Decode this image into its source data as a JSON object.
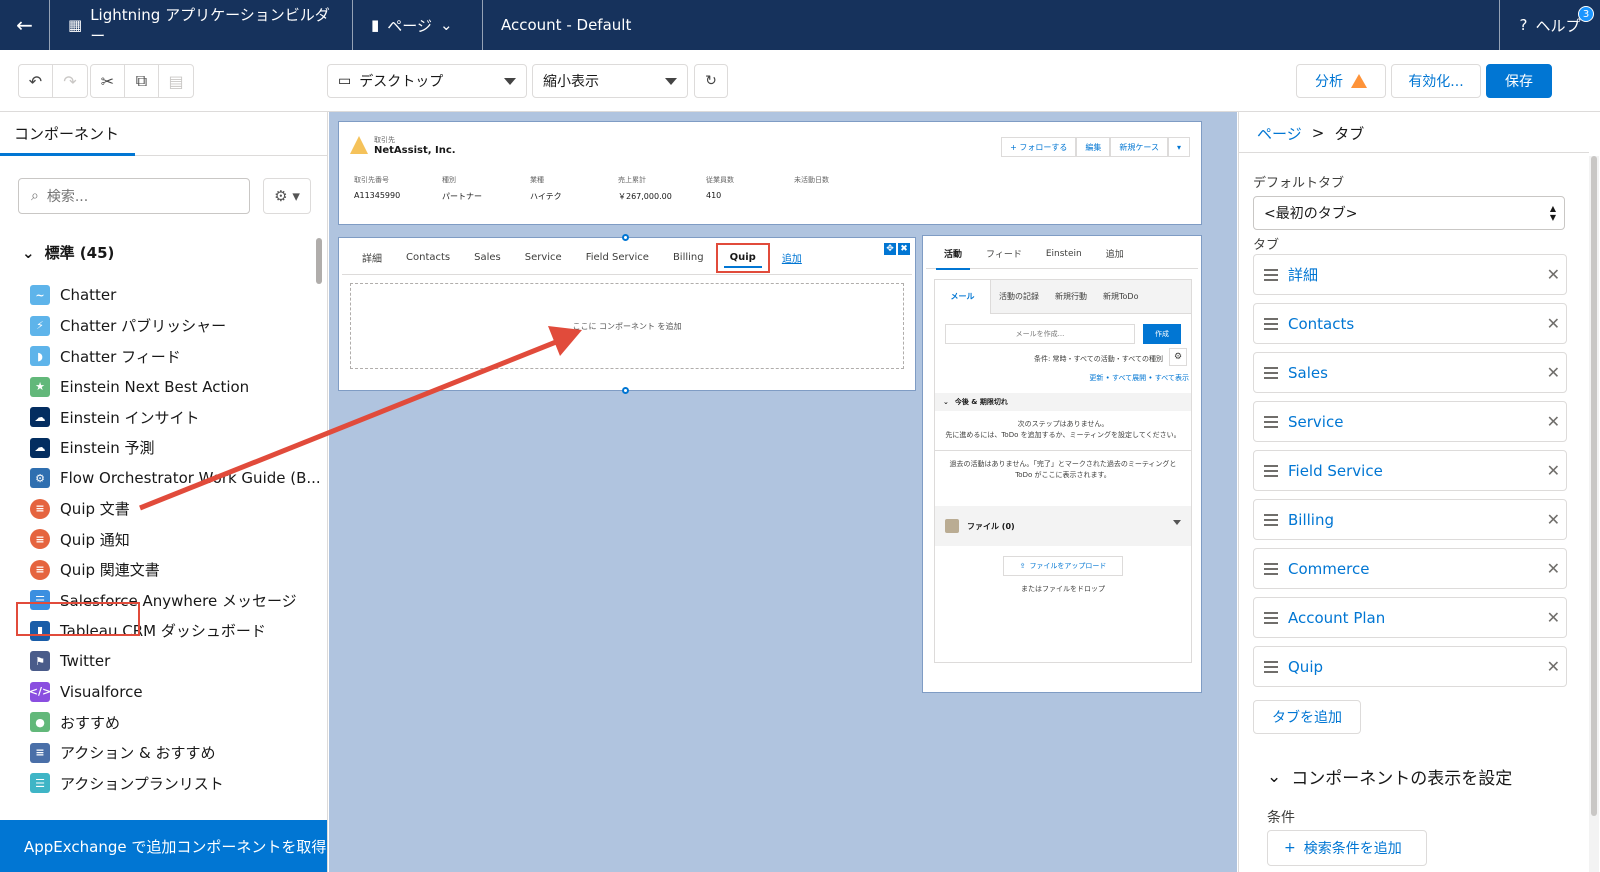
{
  "topbar": {
    "back_icon": "arrow-left-icon",
    "app_name": "Lightning アプリケーションビルダー",
    "page_menu": "ページ",
    "page_title": "Account - Default",
    "help": "ヘルプ",
    "help_badge": "3"
  },
  "toolbar": {
    "device": "デスクトップ",
    "zoom": "縮小表示",
    "analyze": "分析",
    "activate": "有効化...",
    "save": "保存"
  },
  "left": {
    "tab": "コンポーネント",
    "search_placeholder": "検索...",
    "section": "標準 (45)",
    "items": [
      {
        "label": "Chatter",
        "color": "#5eb4ea",
        "glyph": "~"
      },
      {
        "label": "Chatter パブリッシャー",
        "color": "#5eb4ea",
        "glyph": "⚡"
      },
      {
        "label": "Chatter フィード",
        "color": "#5eb4ea",
        "glyph": "◗"
      },
      {
        "label": "Einstein Next Best Action",
        "color": "#62b87a",
        "glyph": "★"
      },
      {
        "label": "Einstein インサイト",
        "color": "#032d60",
        "glyph": "☁"
      },
      {
        "label": "Einstein 予測",
        "color": "#032d60",
        "glyph": "☁"
      },
      {
        "label": "Flow Orchestrator Work Guide (B...",
        "color": "#2f6fb0",
        "glyph": "⚙"
      },
      {
        "label": "Quip 文書",
        "color": "#e5643f",
        "glyph": "≡"
      },
      {
        "label": "Quip 通知",
        "color": "#e5643f",
        "glyph": "≡"
      },
      {
        "label": "Quip 関連文書",
        "color": "#e5643f",
        "glyph": "≡"
      },
      {
        "label": "Salesforce Anywhere メッセージ",
        "color": "#3b8fe0",
        "glyph": "☰"
      },
      {
        "label": "Tableau CRM ダッシュボード",
        "color": "#1a5da8",
        "glyph": "▮"
      },
      {
        "label": "Twitter",
        "color": "#4a5c8a",
        "glyph": "⚑"
      },
      {
        "label": "Visualforce",
        "color": "#8a4ee0",
        "glyph": "</>"
      },
      {
        "label": "おすすめ",
        "color": "#62b87a",
        "glyph": "●"
      },
      {
        "label": "アクション & おすすめ",
        "color": "#4a6fa8",
        "glyph": "≡"
      },
      {
        "label": "アクションプランリスト",
        "color": "#3fb5c6",
        "glyph": "☰"
      }
    ],
    "appexchange": "AppExchange で追加コンポーネントを取得"
  },
  "canvas": {
    "record": {
      "type": "取引先",
      "name": "NetAssist, Inc.",
      "actions": [
        "+ フォローする",
        "編集",
        "新規ケース"
      ],
      "fields": [
        {
          "label": "取引先番号",
          "value": "A11345990"
        },
        {
          "label": "種別",
          "value": "パートナー"
        },
        {
          "label": "業種",
          "value": "ハイテク"
        },
        {
          "label": "売上累計",
          "value": "￥267,000.00"
        },
        {
          "label": "従業員数",
          "value": "410"
        },
        {
          "label": "未活動日数",
          "value": ""
        }
      ]
    },
    "tabs": [
      "詳細",
      "Contacts",
      "Sales",
      "Service",
      "Field Service",
      "Billing",
      "Quip"
    ],
    "tabs_more": "追加",
    "drop_text": "ここに コンポーネント を追加",
    "activity": {
      "tabs": [
        "活動",
        "フィード",
        "Einstein",
        "追加"
      ],
      "subtabs": [
        "メール",
        "活動の記録",
        "新規行動",
        "新規ToDo"
      ],
      "mail_placeholder": "メールを作成...",
      "mail_button": "作成",
      "filter": "条件: 常時・すべての活動・すべての種別",
      "links": "更新 • すべて展開 • すべて表示",
      "upcoming": "今後 & 期限切れ",
      "no_steps": "次のステップはありません。",
      "no_steps_hint": "先に進めるには、ToDo を追加するか、ミーティングを設定してください。",
      "no_past": "過去の活動はありません。「完了」とマークされた過去のミーティングと ToDo がここに表示されます。",
      "files": "ファイル (0)",
      "upload": "ファイルをアップロード",
      "drop_files": "またはファイルをドロップ"
    }
  },
  "right": {
    "crumb_page": "ページ",
    "crumb_sep": ">",
    "crumb_current": "タブ",
    "default_tab_label": "デフォルトタブ",
    "default_tab_value": "<最初のタブ>",
    "tabs_label": "タブ",
    "tabs": [
      "詳細",
      "Contacts",
      "Sales",
      "Service",
      "Field Service",
      "Billing",
      "Commerce",
      "Account Plan",
      "Quip"
    ],
    "add_tab": "タブを追加",
    "visibility": "コンポーネントの表示を設定",
    "conditions": "条件",
    "add_filter": "検索条件を追加"
  },
  "colors": {
    "topbar": "#16325c",
    "brand": "#0176d3",
    "highlight": "#e14b3b",
    "canvas": "#b0c4df"
  }
}
